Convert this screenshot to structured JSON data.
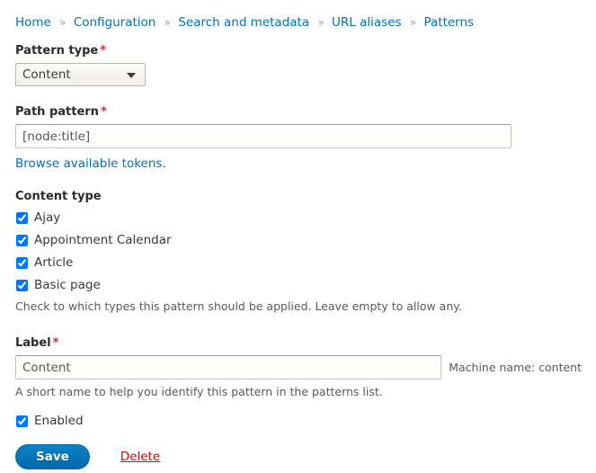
{
  "breadcrumb": {
    "separator": "»",
    "items": [
      {
        "label": "Home"
      },
      {
        "label": "Configuration"
      },
      {
        "label": "Search and metadata"
      },
      {
        "label": "URL aliases"
      },
      {
        "label": "Patterns"
      }
    ]
  },
  "form": {
    "pattern_type": {
      "label": "Pattern type",
      "required_marker": "*",
      "selected": "Content",
      "options": [
        "Content"
      ]
    },
    "path_pattern": {
      "label": "Path pattern",
      "required_marker": "*",
      "value": "[node:title]",
      "placeholder": "",
      "token_link": "Browse available tokens."
    },
    "content_type": {
      "label": "Content type",
      "description": "Check to which types this pattern should be applied. Leave empty to allow any.",
      "items": [
        {
          "label": "Ajay",
          "checked": true
        },
        {
          "label": "Appointment Calendar",
          "checked": true
        },
        {
          "label": "Article",
          "checked": true
        },
        {
          "label": "Basic page",
          "checked": true
        }
      ]
    },
    "label_field": {
      "label": "Label",
      "required_marker": "*",
      "value": "Content",
      "placeholder": "",
      "machine_name": "Machine name: content",
      "description": "A short name to help you identify this pattern in the patterns list."
    },
    "enabled": {
      "label": "Enabled",
      "checked": true
    },
    "actions": {
      "save_label": "Save",
      "delete_label": "Delete"
    }
  },
  "colors": {
    "link": "#0071b8",
    "required": "#e02443",
    "danger": "#e00000",
    "primary_button": "#0071b8"
  }
}
